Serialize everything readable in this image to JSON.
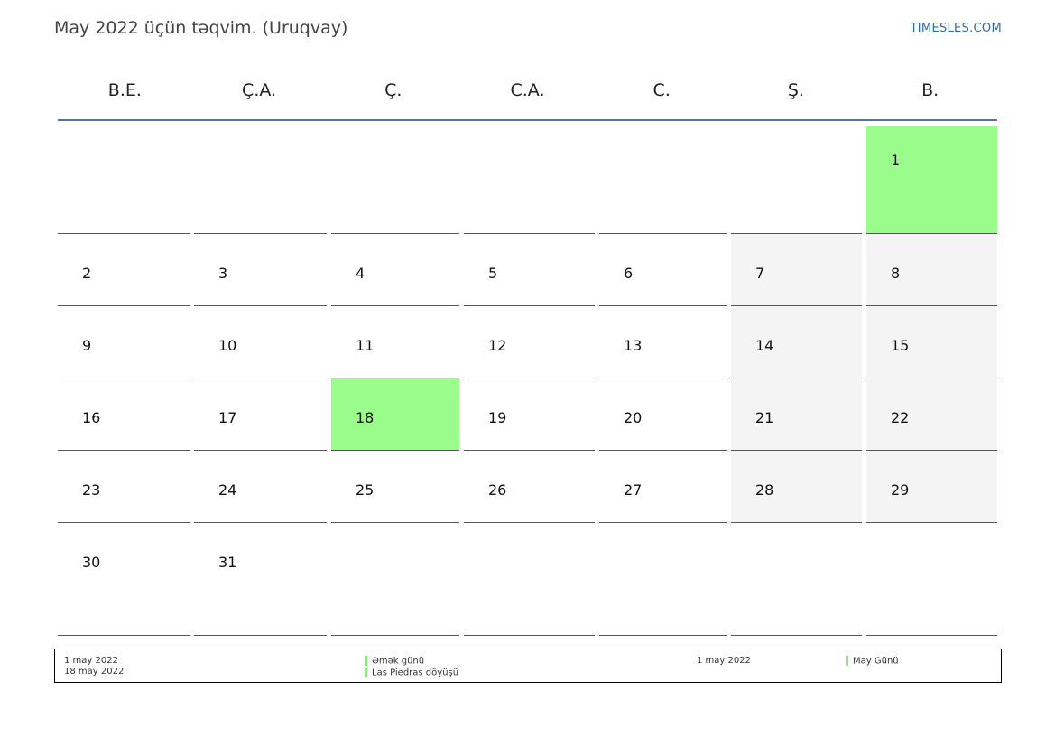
{
  "header": {
    "title": "May 2022 üçün təqvim. (Uruqvay)",
    "site": "TIMESLES.COM"
  },
  "colors": {
    "holiday": "#9afc8a",
    "weekend": "#f4f4f4",
    "accent_rule": "#5a7399",
    "link": "#2e6ea6"
  },
  "weekdays": [
    "B.E.",
    "Ç.A.",
    "Ç.",
    "C.A.",
    "C.",
    "Ş.",
    "B."
  ],
  "weeks": [
    [
      null,
      null,
      null,
      null,
      null,
      null,
      "1"
    ],
    [
      "2",
      "3",
      "4",
      "5",
      "6",
      "7",
      "8"
    ],
    [
      "9",
      "10",
      "11",
      "12",
      "13",
      "14",
      "15"
    ],
    [
      "16",
      "17",
      "18",
      "19",
      "20",
      "21",
      "22"
    ],
    [
      "23",
      "24",
      "25",
      "26",
      "27",
      "28",
      "29"
    ],
    [
      "30",
      "31",
      null,
      null,
      null,
      null,
      null
    ]
  ],
  "holidays": [
    "1",
    "18"
  ],
  "legend": {
    "group1": {
      "dates": [
        "1 may 2022",
        "18 may 2022"
      ],
      "names": [
        "Əmək günü",
        "Las Piedras döyüşü"
      ]
    },
    "group2": {
      "dates": [
        "1 may 2022"
      ],
      "names": [
        "May Günü"
      ]
    }
  }
}
